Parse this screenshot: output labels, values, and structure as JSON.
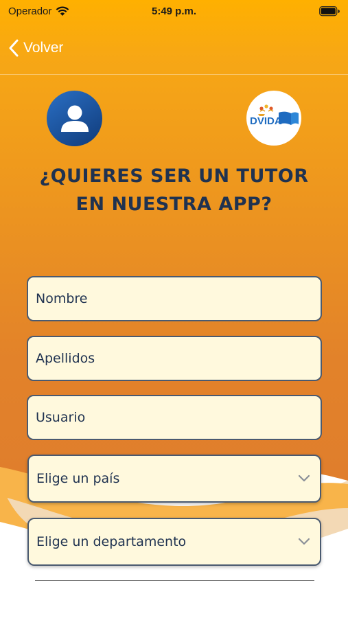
{
  "status_bar": {
    "carrier": "Operador",
    "time": "5:49 p.m."
  },
  "nav": {
    "back_label": "Volver"
  },
  "header": {
    "avatar_icon": "user-icon",
    "logo_text": "DVIDA",
    "title": "¿QUIERES SER UN TUTOR EN NUESTRA APP?"
  },
  "form": {
    "nombre_placeholder": "Nombre",
    "apellidos_placeholder": "Apellidos",
    "usuario_placeholder": "Usuario",
    "pais_select": "Elige un país",
    "departamento_select": "Elige un departamento"
  },
  "colors": {
    "accent_top": "#ffad00",
    "accent_bottom": "#e07f20",
    "title": "#1f3250",
    "field_bg": "#fff9dd"
  }
}
